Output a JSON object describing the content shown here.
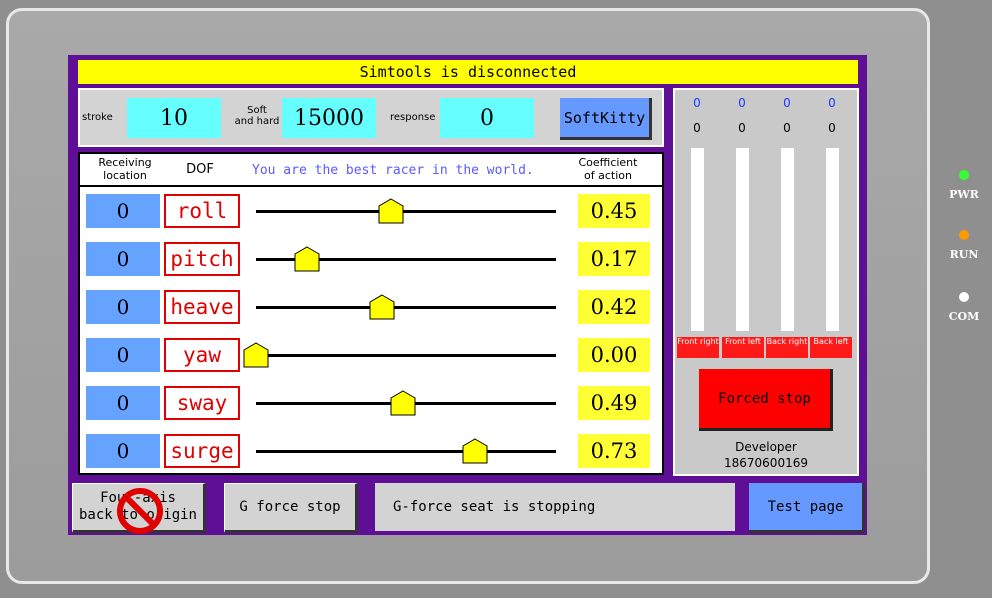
{
  "status_bar": {
    "text": "Simtools is disconnected"
  },
  "settings": {
    "stroke_label": "stroke",
    "stroke_value": "10",
    "soft_hard_label_1": "Soft",
    "soft_hard_label_2": "and hard",
    "soft_hard_value": "15000",
    "response_label": "response",
    "response_value": "0",
    "softkitty_label": "SoftKitty"
  },
  "table": {
    "hdr_receiving_1": "Receiving",
    "hdr_receiving_2": "location",
    "hdr_dof": "DOF",
    "motto": "You are the best racer in the world.",
    "hdr_coef_1": "Coefficient",
    "hdr_coef_2": "of action",
    "rows": [
      {
        "location": "0",
        "dof": "roll",
        "coefficient": "0.45",
        "level": 0.45
      },
      {
        "location": "0",
        "dof": "pitch",
        "coefficient": "0.17",
        "level": 0.17
      },
      {
        "location": "0",
        "dof": "heave",
        "coefficient": "0.42",
        "level": 0.42
      },
      {
        "location": "0",
        "dof": "yaw",
        "coefficient": "0.00",
        "level": 0.0
      },
      {
        "location": "0",
        "dof": "sway",
        "coefficient": "0.49",
        "level": 0.49
      },
      {
        "location": "0",
        "dof": "surge",
        "coefficient": "0.73",
        "level": 0.73
      }
    ]
  },
  "axes_panel": {
    "top_values": [
      "0",
      "0",
      "0",
      "0"
    ],
    "bottom_values": [
      "0",
      "0",
      "0",
      "0"
    ],
    "tags": [
      "Front right",
      "Front left",
      "Back right",
      "Back left"
    ],
    "forced_stop_label": "Forced stop",
    "developer_label": "Developer",
    "developer_phone": "18670600169"
  },
  "bottom": {
    "four_axis_label_1": "Four-axis",
    "four_axis_label_2": "back to origin",
    "g_force_stop_label": "G force stop",
    "status_message": "G-force seat is stopping",
    "test_page_label": "Test page"
  },
  "leds": [
    {
      "label": "PWR",
      "color": "#33ff33"
    },
    {
      "label": "RUN",
      "color": "#ff9900"
    },
    {
      "label": "COM",
      "color": "#ffffff"
    }
  ],
  "colors": {
    "screen_bg": "#5e0f96",
    "status_bar": "#ffff00",
    "dof_red": "#e00000",
    "slider_thumb": "#ffff00",
    "forced_stop": "#ff0000",
    "button_blue": "#6699ff"
  },
  "icons": {
    "four_axis_overlay": "prohibited-icon"
  }
}
